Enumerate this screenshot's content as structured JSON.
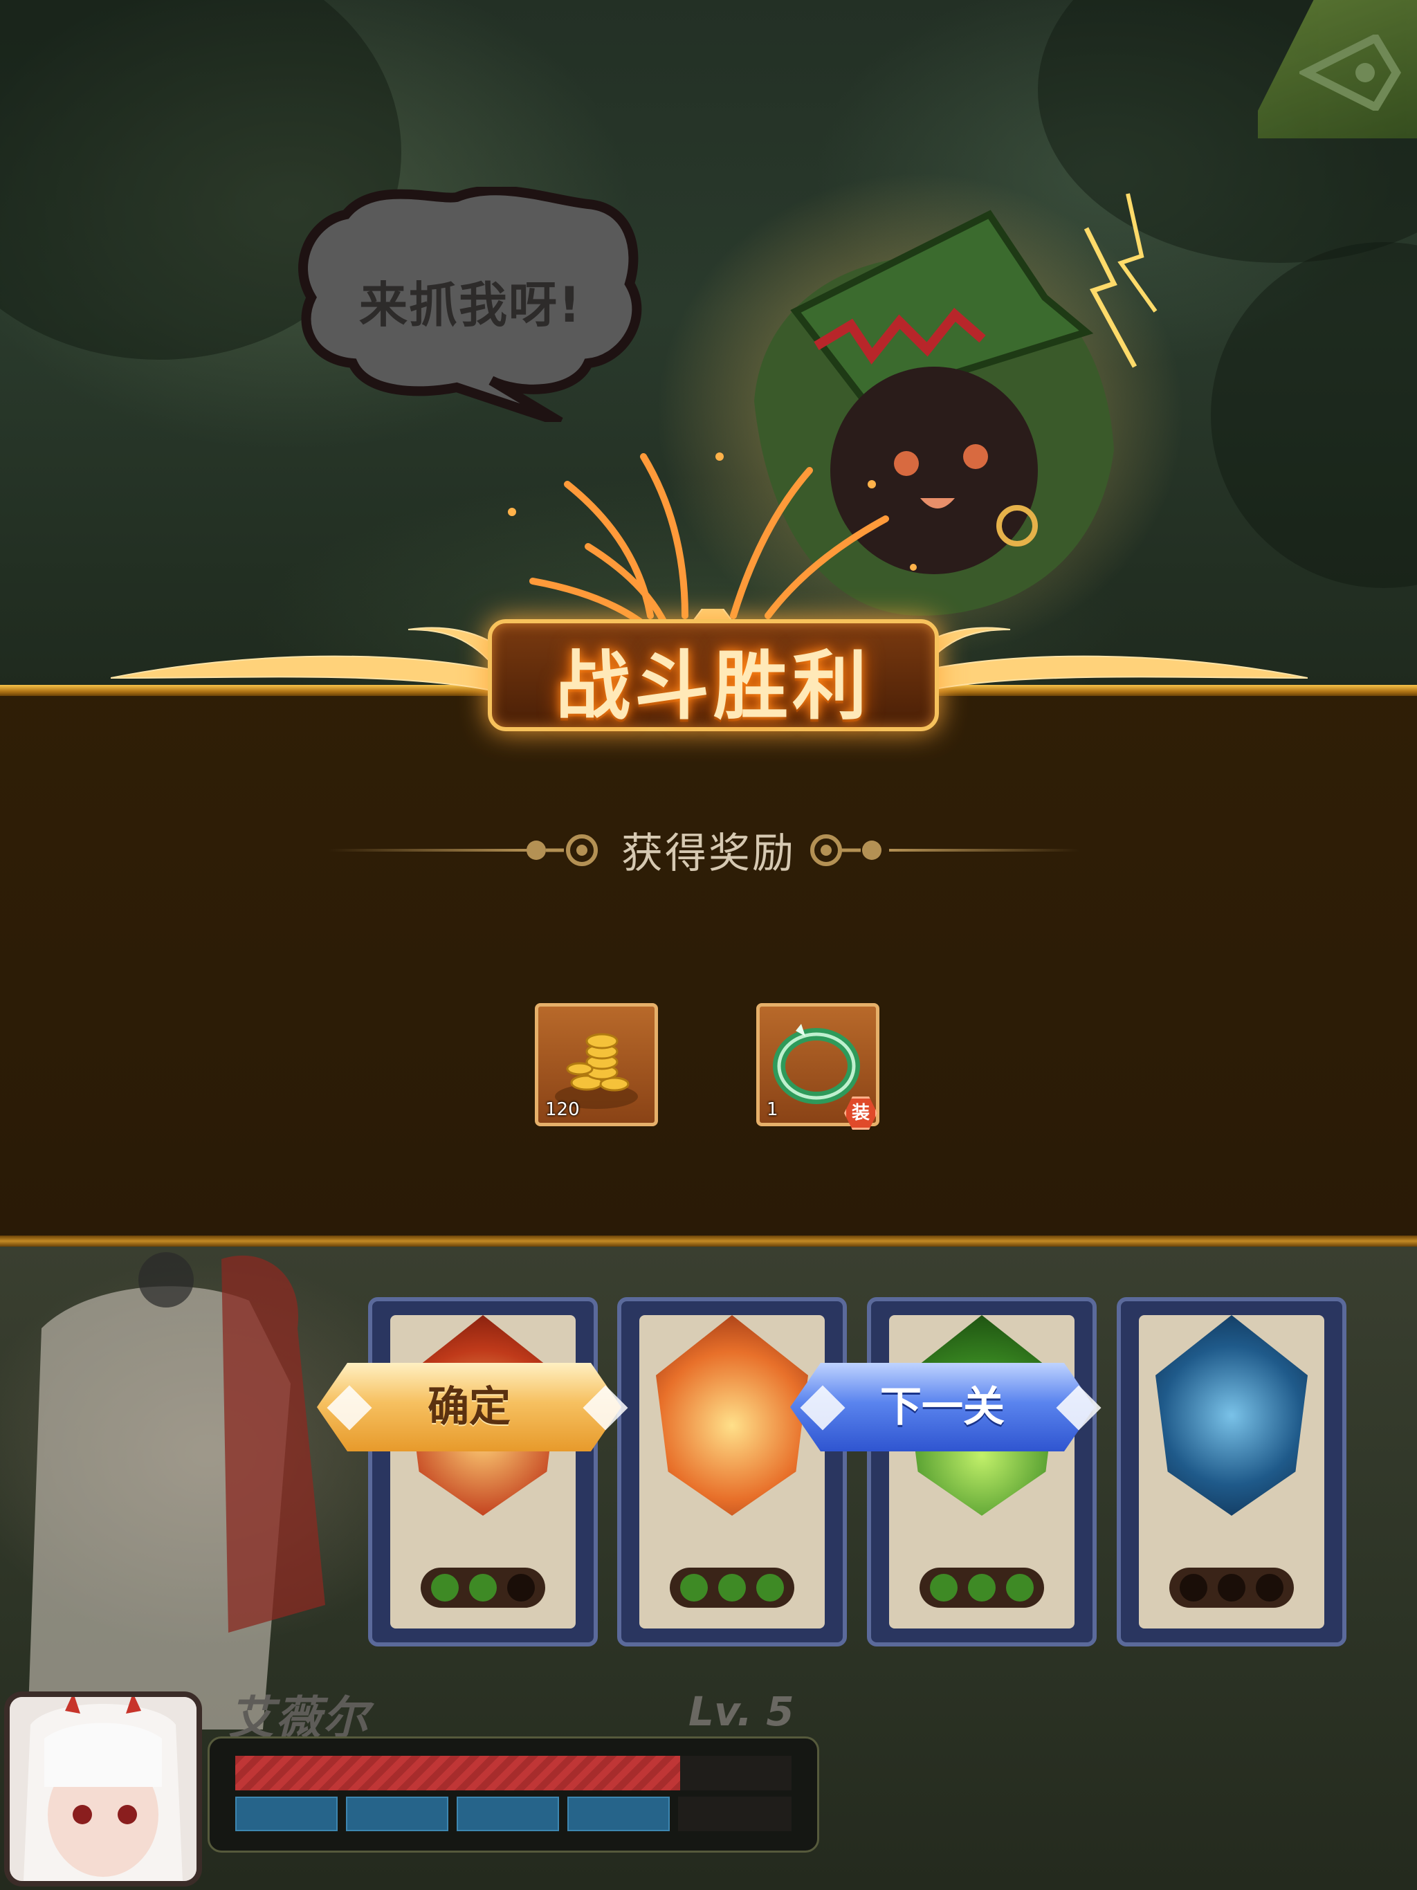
{
  "enemy": {
    "speech": "来抓我呀!"
  },
  "result": {
    "title": "战斗胜利",
    "reward_heading": "获得奖励",
    "rewards": [
      {
        "icon": "gold-coins-icon",
        "count": "120"
      },
      {
        "icon": "jade-ring-icon",
        "count": "1",
        "badge": "装"
      }
    ]
  },
  "buttons": {
    "confirm": "确定",
    "next": "下一关"
  },
  "skills": [
    {
      "gem": "red-fire-gem-icon",
      "pips": [
        1,
        1,
        0
      ]
    },
    {
      "gem": "orange-fire-gem-icon",
      "pips": [
        1,
        1,
        1
      ]
    },
    {
      "gem": "green-nature-gem-icon",
      "pips": [
        1,
        1,
        1
      ]
    },
    {
      "gem": "blue-water-gem-icon",
      "pips": [
        0,
        0,
        0
      ]
    }
  ],
  "hero": {
    "name": "艾薇尔",
    "level": "Lv. 5",
    "hp_fraction": 0.8,
    "mp_segments_filled": 4,
    "mp_segments_total": 5
  },
  "colors": {
    "panel": "#2f1e06",
    "gold": "#f6c14a",
    "confirm_button": "#f6c060",
    "next_button": "#4a72e6",
    "pip_on": "#3e8a25"
  }
}
